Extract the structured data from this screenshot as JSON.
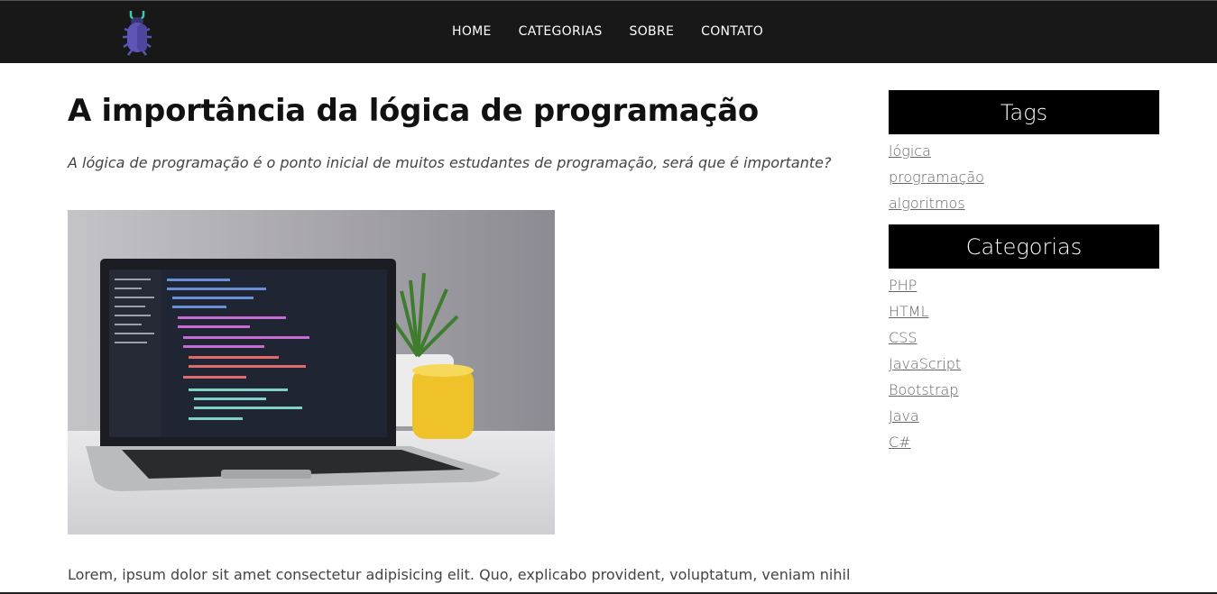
{
  "header": {
    "logo_icon": "bug-icon",
    "nav": [
      "HOME",
      "CATEGORIAS",
      "SOBRE",
      "CONTATO"
    ]
  },
  "article": {
    "title": "A importância da lógica de programação",
    "subtitle": "A lógica de programação é o ponto inicial de muitos estudantes de programação, será que é importante?",
    "image_icon": "laptop-photo",
    "body": "Lorem, ipsum dolor sit amet consectetur adipisicing elit. Quo, explicabo provident, voluptatum, veniam nihil"
  },
  "sidebar": {
    "tags_title": "Tags",
    "tags": [
      "lógica",
      "programação",
      "algoritmos"
    ],
    "categories_title": "Categorias",
    "categories": [
      "PHP",
      "HTML",
      "CSS",
      "JavaScript",
      "Bootstrap",
      "Java",
      "C#"
    ]
  },
  "colors": {
    "topbar": "#181818",
    "sidebar_head": "#000000",
    "link": "#666666",
    "logo": "#5e55b8"
  }
}
